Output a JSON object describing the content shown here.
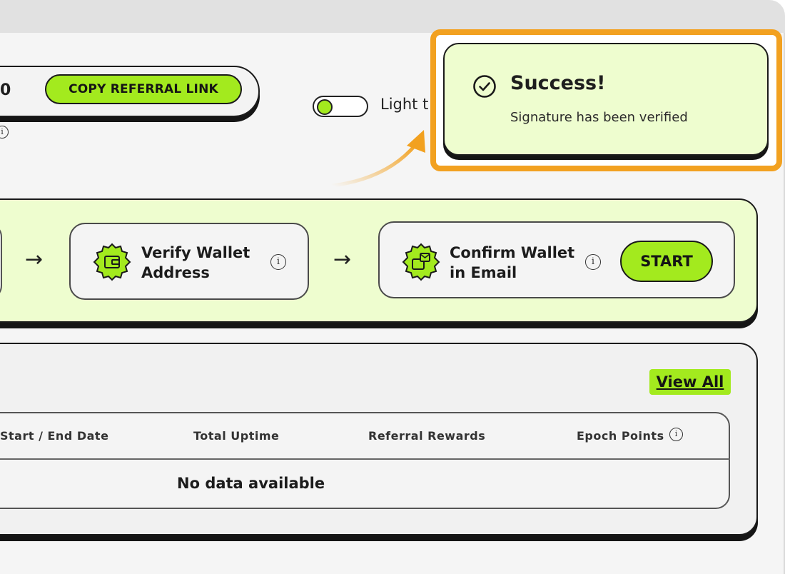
{
  "referral": {
    "value_fragment": "0",
    "copy_button_label": "COPY REFERRAL LINK",
    "info_glyph": "i"
  },
  "theme_toggle": {
    "label": "Light t",
    "state": "on"
  },
  "toast": {
    "title": "Success!",
    "message": "Signature has been verified",
    "icon": "check-circle-icon"
  },
  "steps": {
    "items": [
      {
        "label": "Verify Wallet\nAddress",
        "icon": "wallet-icon",
        "info_glyph": "i"
      },
      {
        "label": "Confirm Wallet\nin Email",
        "icon": "email-wallet-icon",
        "info_glyph": "i",
        "action_label": "START"
      }
    ],
    "arrow_glyph": "→"
  },
  "history": {
    "view_all_label": "View All",
    "columns": [
      "Start / End Date",
      "Total Uptime",
      "Referral Rewards",
      "Epoch Points"
    ],
    "epoch_info_glyph": "i",
    "empty_message": "No data available"
  },
  "colors": {
    "accent_green": "#a3ea1e",
    "panel_green": "#eefdcf",
    "highlight_orange": "#f2a120",
    "ink": "#1a1a1a"
  }
}
